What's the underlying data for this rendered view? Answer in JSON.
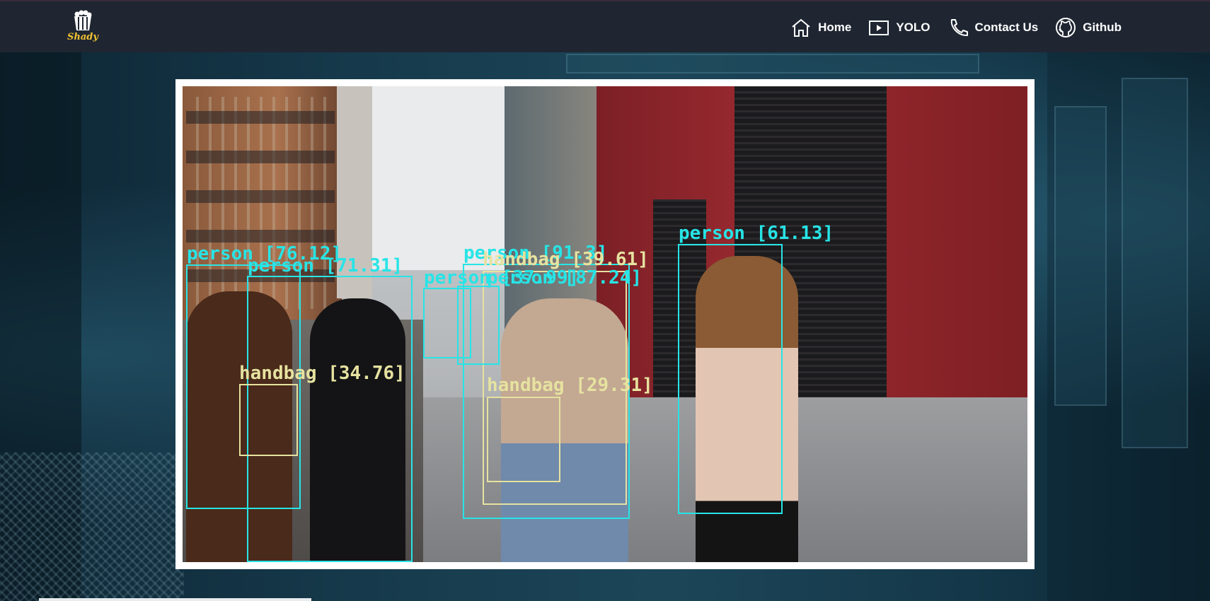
{
  "window": {
    "title": "Shady"
  },
  "brand": {
    "name": "Shady",
    "accent": "#f2c230"
  },
  "nav": {
    "items": [
      {
        "label": "Home",
        "icon": "home-icon"
      },
      {
        "label": "YOLO",
        "icon": "play-icon"
      },
      {
        "label": "Contact Us",
        "icon": "phone-icon"
      },
      {
        "label": "Github",
        "icon": "github-icon"
      }
    ]
  },
  "colors": {
    "navbar": "#1f2632",
    "person_box": "#27e4e6",
    "handbag_box": "#e6e2a0"
  },
  "detections": [
    {
      "label": "person [76.12]"
    },
    {
      "label": "person [71.31]"
    },
    {
      "label": "person [91.3]"
    },
    {
      "label": "handbag [39.61]"
    },
    {
      "label": "person [37.99]"
    },
    {
      "label": "person [87.24]"
    },
    {
      "label": "person [61.13]"
    },
    {
      "label": "handbag [34.76]"
    },
    {
      "label": "handbag [29.31]"
    }
  ]
}
